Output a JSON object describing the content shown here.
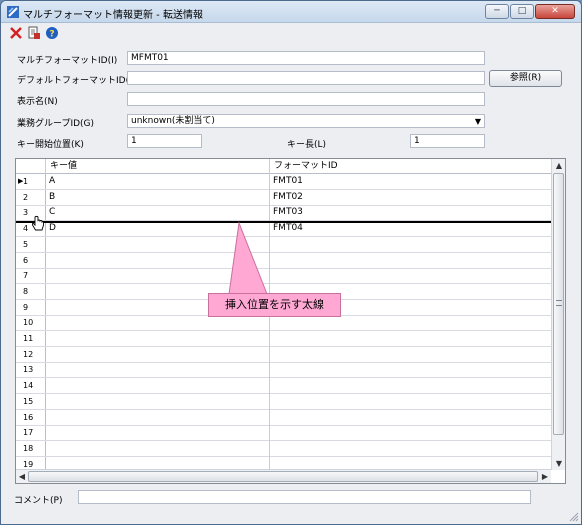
{
  "window": {
    "title": "マルチフォーマット情報更新 - 転送情報"
  },
  "window_buttons": [
    "─",
    "□",
    "✕"
  ],
  "toolbar": {
    "icons": [
      "delete-icon",
      "save-document-icon",
      "help-icon"
    ]
  },
  "form": {
    "multi_format_id": {
      "label": "マルチフォーマットID(I)",
      "value": "MFMT01"
    },
    "default_format_id": {
      "label": "デフォルトフォーマットID(J)",
      "value": ""
    },
    "browse_button": "参照(R)",
    "display_name": {
      "label": "表示名(N)",
      "value": ""
    },
    "business_group_id": {
      "label": "業務グループID(G)",
      "value": "unknown(未割当て)"
    },
    "key_start": {
      "label": "キー開始位置(K)",
      "value": "1"
    },
    "key_length": {
      "label": "キー長(L)",
      "value": "1"
    },
    "comment": {
      "label": "コメント(P)",
      "value": ""
    }
  },
  "grid": {
    "columns": [
      "キー値",
      "フォーマットID"
    ],
    "current_row_marker": "▶",
    "rows": [
      {
        "no": "1",
        "key": "A",
        "format": "FMT01"
      },
      {
        "no": "2",
        "key": "B",
        "format": "FMT02"
      },
      {
        "no": "3",
        "key": "C",
        "format": "FMT03"
      },
      {
        "no": "4",
        "key": "D",
        "format": "FMT04"
      },
      {
        "no": "5",
        "key": "",
        "format": ""
      },
      {
        "no": "6",
        "key": "",
        "format": ""
      },
      {
        "no": "7",
        "key": "",
        "format": ""
      },
      {
        "no": "8",
        "key": "",
        "format": ""
      },
      {
        "no": "9",
        "key": "",
        "format": ""
      },
      {
        "no": "10",
        "key": "",
        "format": ""
      },
      {
        "no": "11",
        "key": "",
        "format": ""
      },
      {
        "no": "12",
        "key": "",
        "format": ""
      },
      {
        "no": "13",
        "key": "",
        "format": ""
      },
      {
        "no": "14",
        "key": "",
        "format": ""
      },
      {
        "no": "15",
        "key": "",
        "format": ""
      },
      {
        "no": "16",
        "key": "",
        "format": ""
      },
      {
        "no": "17",
        "key": "",
        "format": ""
      },
      {
        "no": "18",
        "key": "",
        "format": ""
      },
      {
        "no": "19",
        "key": "",
        "format": ""
      }
    ]
  },
  "callout": {
    "text": "挿入位置を示す太線"
  },
  "colors": {
    "callout_fill": "#ffa8d4",
    "callout_border": "#c9709e"
  }
}
